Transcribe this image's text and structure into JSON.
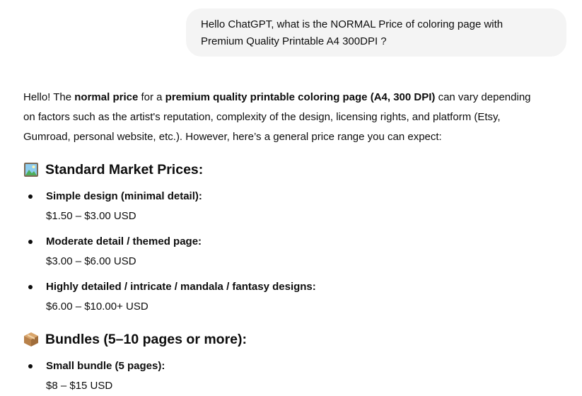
{
  "user_message": {
    "line1": "Hello ChatGPT, what is the NORMAL Price of coloring page with",
    "line2": "Premium Quality Printable A4 300DPI ?"
  },
  "answer": {
    "intro_1": "Hello! The ",
    "intro_b1": "normal price",
    "intro_2": " for a ",
    "intro_b2": "premium quality printable coloring page (A4, 300 DPI)",
    "intro_3": " can vary depending",
    "intro_line2": "on factors such as the artist's reputation, complexity of the design, licensing rights, and platform (Etsy,",
    "intro_line3": "Gumroad, personal website, etc.). However, here’s a general price range you can expect:"
  },
  "sections": [
    {
      "icon": "framed-picture-icon",
      "title": "Standard Market Prices:",
      "items": [
        {
          "title": "Simple design (minimal detail):",
          "value": "$1.50 – $3.00 USD"
        },
        {
          "title": "Moderate detail / themed page:",
          "value": "$3.00 – $6.00 USD"
        },
        {
          "title": "Highly detailed / intricate / mandala / fantasy designs:",
          "value": "$6.00 – $10.00+ USD"
        }
      ]
    },
    {
      "icon": "package-box-icon",
      "title": "Bundles (5–10 pages or more):",
      "items": [
        {
          "title": "Small bundle (5 pages):",
          "value": "$8 – $15 USD"
        }
      ]
    }
  ]
}
